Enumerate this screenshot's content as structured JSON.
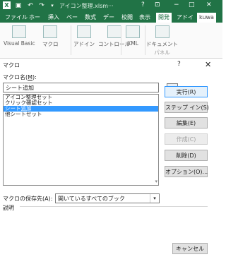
{
  "titlebar": {
    "app_icon": "X",
    "save_icon": "save-icon",
    "undo_icon": "undo-icon",
    "redo_icon": "redo-icon",
    "title": "アイコン整理.xlsm···",
    "help": "?",
    "restore_icon": "ribbon-display-icon",
    "minimize": "−",
    "maximize": "□",
    "close": "✕"
  },
  "ribbon_tabs": [
    "ファイル",
    "ホー",
    "挿入",
    "ペー",
    "数式",
    "デー",
    "校閲",
    "表示",
    "開発",
    "アドイ"
  ],
  "ribbon_user": "kuwa",
  "ribbon_items": [
    "Visual Basic",
    "マクロ",
    "アドイン",
    "コントロール",
    "XML",
    "ドキュメント"
  ],
  "ribbon_partial": "パネル",
  "dialog": {
    "title": "マクロ",
    "help": "?",
    "close": "✕",
    "macro_name_label": "マクロ名(",
    "macro_name_key": "M",
    "macro_name_label_end": "):",
    "macro_name_value": "シート追加",
    "macros": [
      "アイコン整理セット",
      "クリック確認セット",
      "シート追加",
      "他シートセット"
    ],
    "selected_index": 2,
    "buttons": {
      "run": "実行(R)",
      "step_in": "ステップ イン(S)",
      "edit": "編集(E)",
      "create": "作成(C)",
      "delete": "削除(D)",
      "options": "オプション(O)..."
    },
    "store_label": "マクロの保存先(A):",
    "store_value": "開いているすべてのブック",
    "description_label": "説明",
    "cancel": "キャンセル"
  }
}
